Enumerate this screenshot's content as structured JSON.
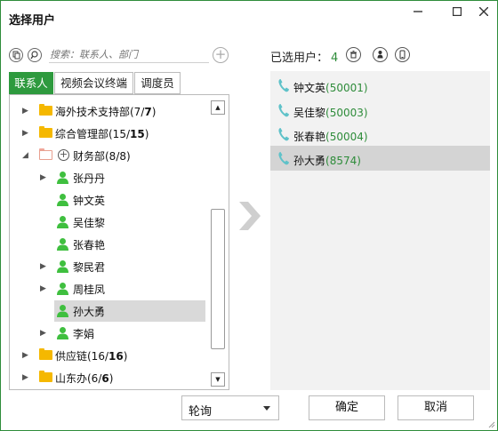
{
  "window": {
    "title": "选择用户",
    "minimize_glyph": "—",
    "maximize_glyph": "□",
    "close_glyph": "✕"
  },
  "search": {
    "placeholder": "搜索：联系人、部门"
  },
  "tabs": [
    {
      "label": "联系人",
      "active": true
    },
    {
      "label": "视频会议终端",
      "active": false
    },
    {
      "label": "调度员",
      "active": false
    }
  ],
  "tree": {
    "nodes": [
      {
        "label": "海外技术支持部(7/",
        "bold": "7",
        "tail": ")",
        "type": "folder",
        "expanded": false
      },
      {
        "label": "综合管理部(15/",
        "bold": "15",
        "tail": ")",
        "type": "folder",
        "expanded": false
      },
      {
        "label": "财务部(8/8)",
        "bold": "",
        "tail": "",
        "type": "folder-open",
        "expanded": true
      },
      {
        "label": "张丹丹",
        "type": "person",
        "has_children": true
      },
      {
        "label": "钟文英",
        "type": "person",
        "has_children": false
      },
      {
        "label": "吴佳黎",
        "type": "person",
        "has_children": false
      },
      {
        "label": "张春艳",
        "type": "person",
        "has_children": false
      },
      {
        "label": "黎民君",
        "type": "person",
        "has_children": true
      },
      {
        "label": "周桂凤",
        "type": "person",
        "has_children": true
      },
      {
        "label": "孙大勇",
        "type": "person",
        "has_children": false,
        "selected": true
      },
      {
        "label": "李娟",
        "type": "person",
        "has_children": true
      },
      {
        "label": "供应链(16/",
        "bold": "16",
        "tail": ")",
        "type": "folder",
        "expanded": false
      },
      {
        "label": "山东办(6/",
        "bold": "6",
        "tail": ")",
        "type": "folder",
        "expanded": false
      }
    ]
  },
  "selected": {
    "label": "已选用户：",
    "count": "4",
    "users": [
      {
        "name": "钟文英",
        "id": "(50001)",
        "selected": false
      },
      {
        "name": "吴佳黎",
        "id": "(50003)",
        "selected": false
      },
      {
        "name": "张春艳",
        "id": "(50004)",
        "selected": false
      },
      {
        "name": "孙大勇",
        "id": "(8574)",
        "selected": true
      }
    ]
  },
  "bottom": {
    "mode_value": "轮询",
    "confirm_label": "确定",
    "cancel_label": "取消"
  },
  "colors": {
    "accent": "#2e9a3e",
    "folder": "#f5b800",
    "person": "#3fbf3f",
    "phone": "#5fc2c9"
  }
}
